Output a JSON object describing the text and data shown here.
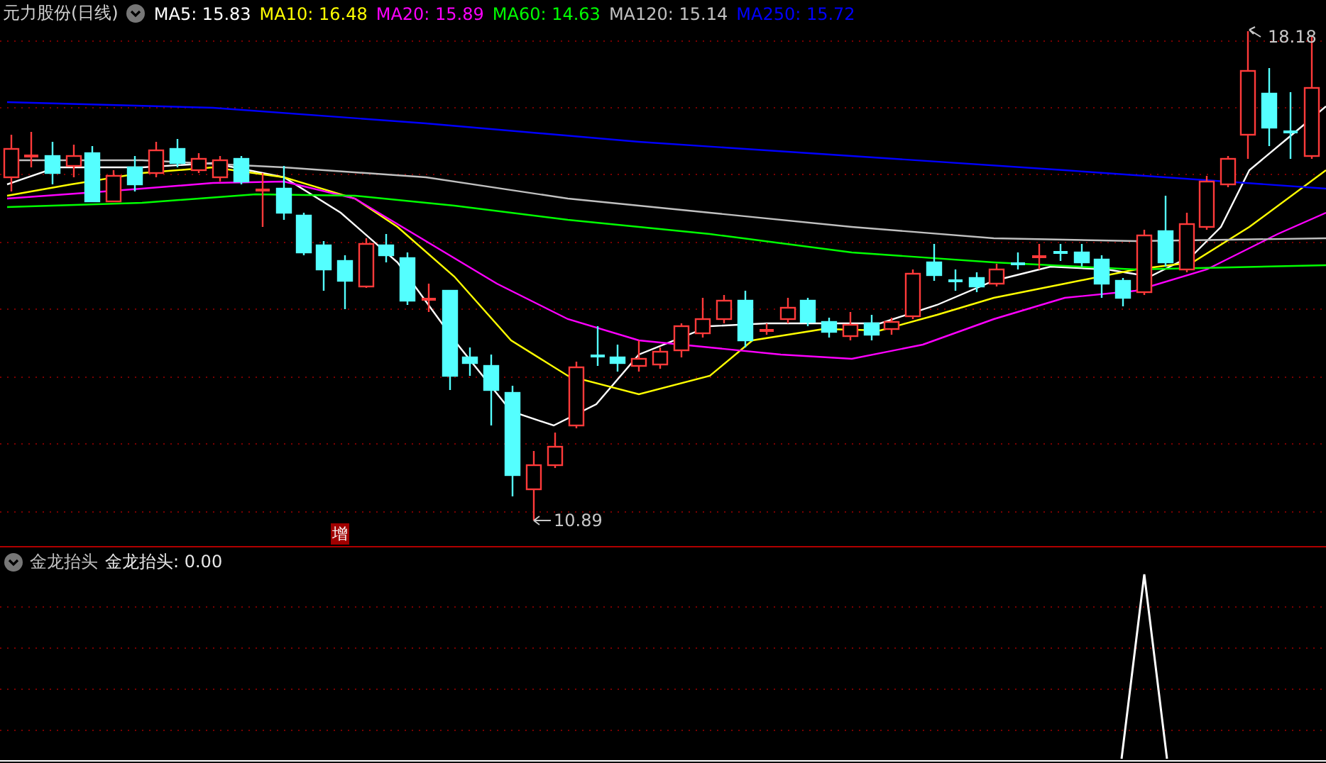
{
  "title": {
    "name": "元力股份(日线)"
  },
  "ma_legend": [
    {
      "label": "MA5: 15.83",
      "color": "#ffffff"
    },
    {
      "label": "MA10: 16.48",
      "color": "#ffff00"
    },
    {
      "label": "MA20: 15.89",
      "color": "#ff00ff"
    },
    {
      "label": "MA60: 14.63",
      "color": "#00ff00"
    },
    {
      "label": "MA120: 15.14",
      "color": "#c0c0c0"
    },
    {
      "label": "MA250: 15.72",
      "color": "#0000ff"
    }
  ],
  "price_chart": {
    "high_label": "18.18",
    "low_label": "10.89",
    "marker": "增"
  },
  "indicator": {
    "name": "金龙抬头",
    "value_label": "金龙抬头: 0.00"
  }
}
